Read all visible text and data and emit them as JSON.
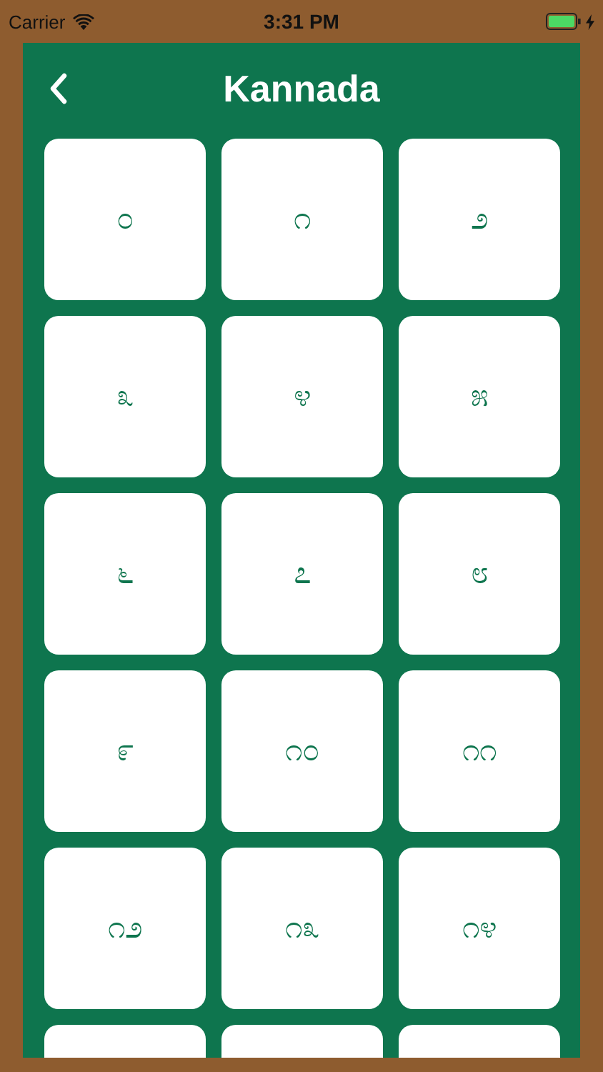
{
  "status_bar": {
    "carrier": "Carrier",
    "time": "3:31 PM",
    "charging": true
  },
  "header": {
    "title": "Kannada"
  },
  "numerals": [
    {
      "kind": "numeral",
      "text": "೦"
    },
    {
      "kind": "numeral",
      "text": "೧"
    },
    {
      "kind": "numeral",
      "text": "೨"
    },
    {
      "kind": "numeral",
      "text": "೩"
    },
    {
      "kind": "numeral",
      "text": "೪"
    },
    {
      "kind": "numeral",
      "text": "೫"
    },
    {
      "kind": "numeral",
      "text": "೬"
    },
    {
      "kind": "numeral",
      "text": "೭"
    },
    {
      "kind": "numeral",
      "text": "೮"
    },
    {
      "kind": "numeral",
      "text": "೯"
    },
    {
      "kind": "numeral",
      "text": "೧೦"
    },
    {
      "kind": "numeral",
      "text": "೧೧"
    },
    {
      "kind": "numeral",
      "text": "೧೨"
    },
    {
      "kind": "numeral",
      "text": "೧೩"
    },
    {
      "kind": "numeral",
      "text": "೧೪"
    },
    {
      "kind": "cut_off"
    },
    {
      "kind": "cut_off"
    },
    {
      "kind": "cut_off"
    }
  ]
}
